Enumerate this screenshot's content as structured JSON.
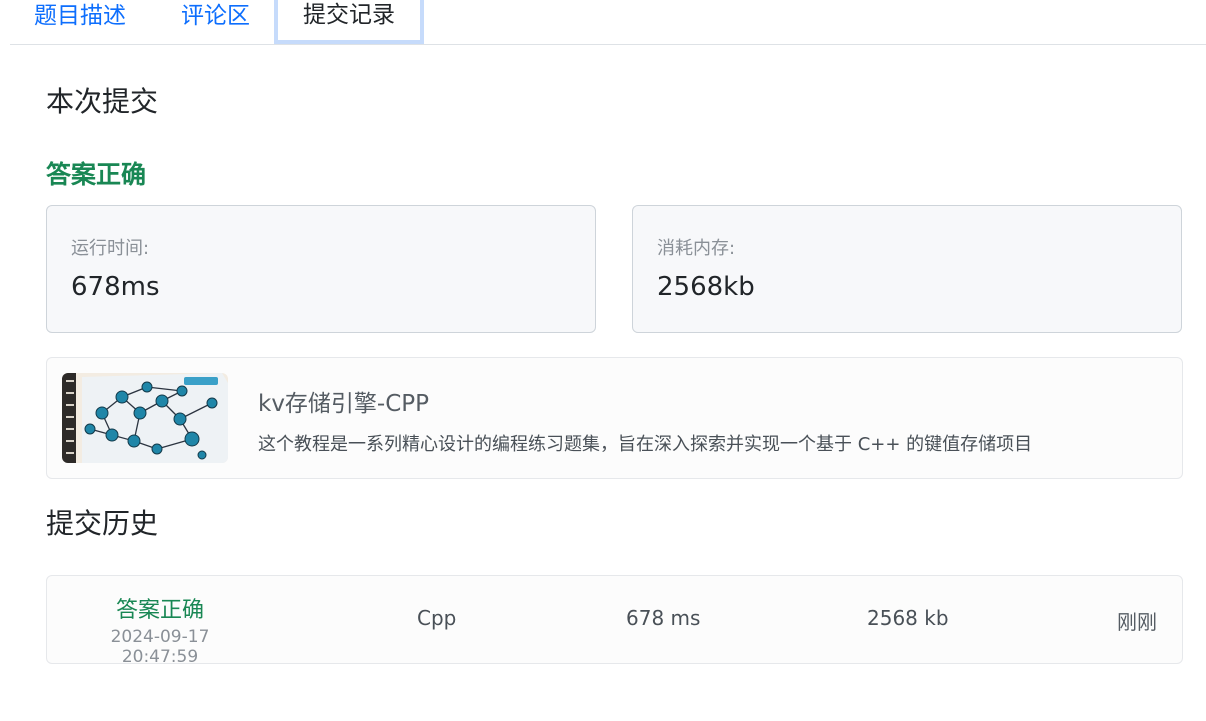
{
  "tabs": [
    {
      "label": "题目描述",
      "active": false
    },
    {
      "label": "评论区",
      "active": false
    },
    {
      "label": "提交记录",
      "active": true
    }
  ],
  "current": {
    "title": "本次提交",
    "status": "答案正确",
    "runtime_label": "运行时间:",
    "runtime_value": "678ms",
    "memory_label": "消耗内存:",
    "memory_value": "2568kb"
  },
  "course": {
    "title": "kv存储引擎-CPP",
    "description": "这个教程是一系列精心设计的编程练习题集，旨在深入探索并实现一个基于 C++ 的键值存储项目"
  },
  "history": {
    "title": "提交历史",
    "rows": [
      {
        "status": "答案正确",
        "timestamp": "2024-09-17 20:47:59",
        "language": "Cpp",
        "runtime": "678 ms",
        "memory": "2568 kb",
        "when": "刚刚"
      }
    ]
  },
  "colors": {
    "accent": "#0d6efd",
    "success": "#198754",
    "active_tab_border": "#c6dbfb"
  }
}
